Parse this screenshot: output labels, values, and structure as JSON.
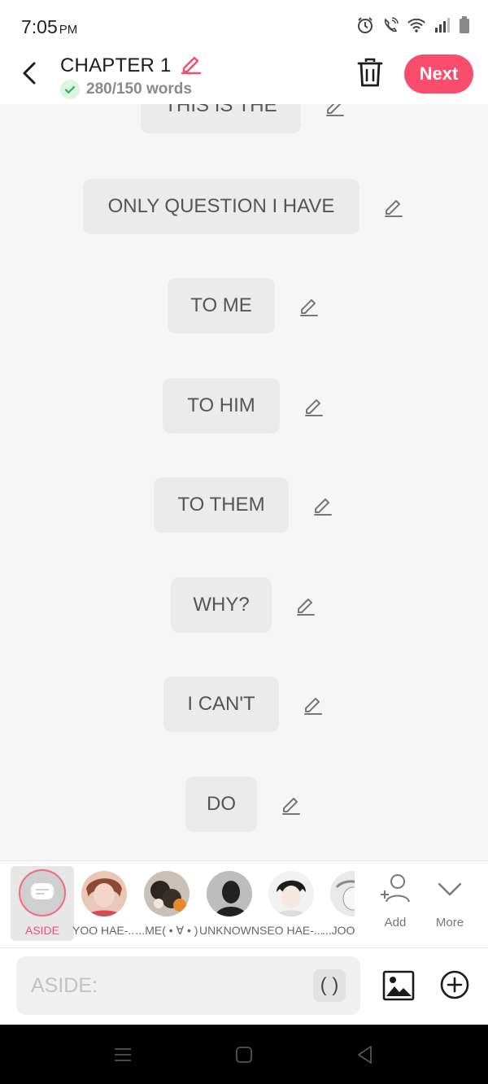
{
  "status_bar": {
    "time": "7:05",
    "ampm": "PM",
    "icons": [
      "alarm-icon",
      "wifi-calling-icon",
      "wifi-icon",
      "signal-icon",
      "battery-icon"
    ]
  },
  "header": {
    "title": "CHAPTER 1",
    "word_count": "280/150 words",
    "next_label": "Next",
    "accent_color": "#fa4d6e"
  },
  "messages": [
    {
      "text": "THIS IS THE"
    },
    {
      "text": "ONLY QUESTION I HAVE"
    },
    {
      "text": "TO ME"
    },
    {
      "text": "TO HIM"
    },
    {
      "text": "TO THEM"
    },
    {
      "text": "WHY?"
    },
    {
      "text": "I CAN'T"
    },
    {
      "text": "DO"
    }
  ],
  "characters": [
    {
      "name": "ASIDE",
      "selected": true
    },
    {
      "name": "YOO HAE-..."
    },
    {
      "name": "...ME( • ∀ • )"
    },
    {
      "name": "UNKNOWN"
    },
    {
      "name": "SEO HAE-..."
    },
    {
      "name": "...JOON"
    }
  ],
  "character_actions": {
    "add_label": "Add",
    "more_label": "More"
  },
  "input": {
    "placeholder": "ASIDE:",
    "paren_label": "( )"
  }
}
